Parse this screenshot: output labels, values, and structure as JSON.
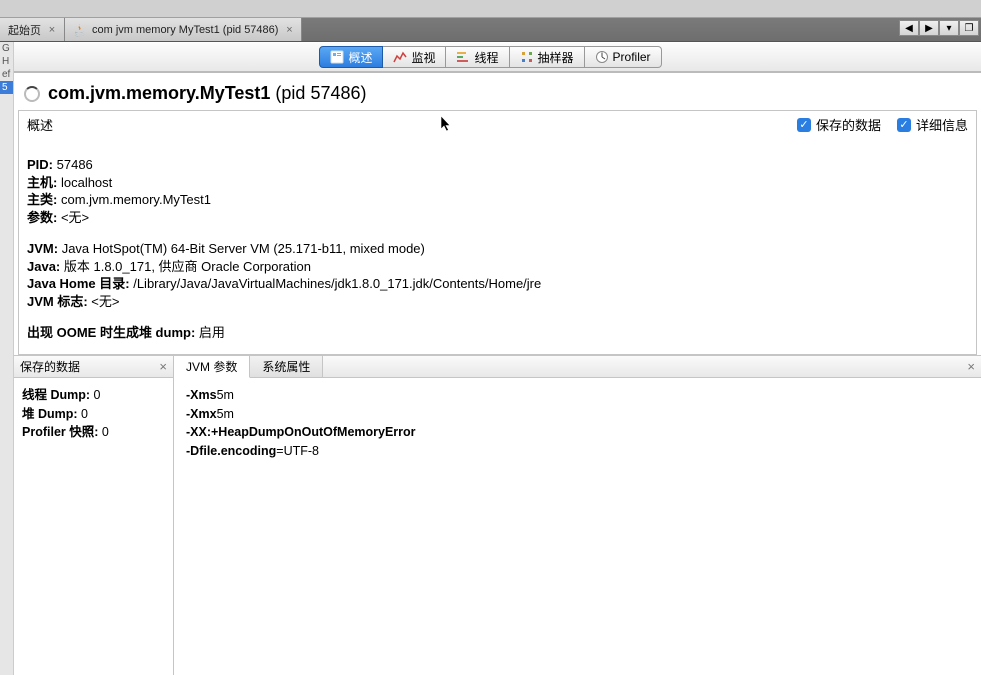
{
  "tabs": {
    "start": {
      "label": "起始页"
    },
    "main": {
      "label": "com jvm memory MyTest1 (pid 57486)"
    }
  },
  "toolbar": {
    "overview": "概述",
    "monitor": "监视",
    "threads": "线程",
    "sampler": "抽样器",
    "profiler": "Profiler"
  },
  "heading": {
    "class": "com.jvm.memory.MyTest1",
    "pid_suffix": " (pid 57486)"
  },
  "overview": {
    "title": "概述",
    "save_data_label": "保存的数据",
    "detail_label": "详细信息"
  },
  "info": {
    "pid_label": "PID:",
    "pid": "57486",
    "host_label": "主机:",
    "host": "localhost",
    "mainclass_label": "主类:",
    "mainclass": "com.jvm.memory.MyTest1",
    "args_label": "参数:",
    "args": "<无>",
    "jvm_label": "JVM:",
    "jvm": "Java HotSpot(TM) 64-Bit Server VM (25.171-b11, mixed mode)",
    "java_label": "Java:",
    "java": "版本 1.8.0_171, 供应商 Oracle Corporation",
    "javahome_label": "Java Home 目录:",
    "javahome": "/Library/Java/JavaVirtualMachines/jdk1.8.0_171.jdk/Contents/Home/jre",
    "jvmflags_label": "JVM 标志:",
    "jvmflags": "<无>",
    "oome_label": "出现 OOME 时生成堆 dump:",
    "oome": "启用"
  },
  "saved": {
    "header": "保存的数据",
    "thread_dump_label": "线程 Dump:",
    "thread_dump": "0",
    "heap_dump_label": "堆 Dump:",
    "heap_dump": "0",
    "profiler_snap_label": "Profiler 快照:",
    "profiler_snap": "0"
  },
  "paramtabs": {
    "jvm_args": "JVM 参数",
    "sys_props": "系统属性"
  },
  "jvmargs": {
    "l1a": "-Xms",
    "l1b": "5m",
    "l2a": "-Xmx",
    "l2b": "5m",
    "l3a": "-XX:+HeapDumpOnOutOfMemoryError",
    "l4a": "-Dfile.encoding",
    "l4b": "=UTF-8"
  },
  "leftgutter": {
    "a": "G",
    "b": "H",
    "c": "ef",
    "d": "5"
  }
}
